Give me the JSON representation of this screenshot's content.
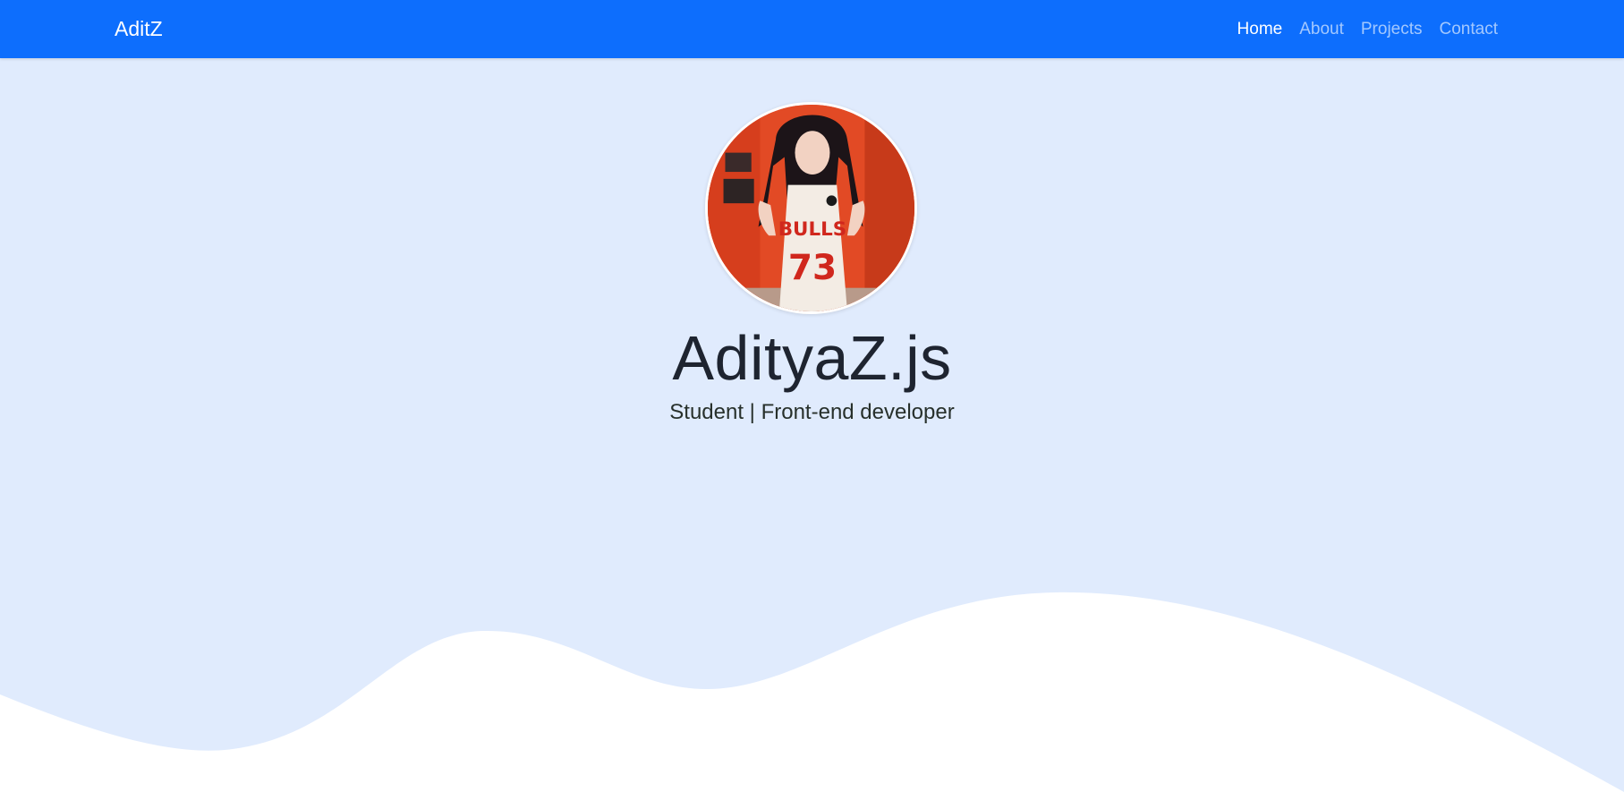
{
  "navbar": {
    "brand": "AditZ",
    "links": [
      {
        "label": "Home",
        "active": true
      },
      {
        "label": "About",
        "active": false
      },
      {
        "label": "Projects",
        "active": false
      },
      {
        "label": "Contact",
        "active": false
      }
    ]
  },
  "hero": {
    "avatar_icon": "profile-photo",
    "title": "AdityaZ.js",
    "subtitle": "Student | Front-end developer"
  },
  "colors": {
    "navbar_bg": "#0d6efd",
    "hero_bg": "#e0ebfd",
    "wave": "#ffffff"
  }
}
